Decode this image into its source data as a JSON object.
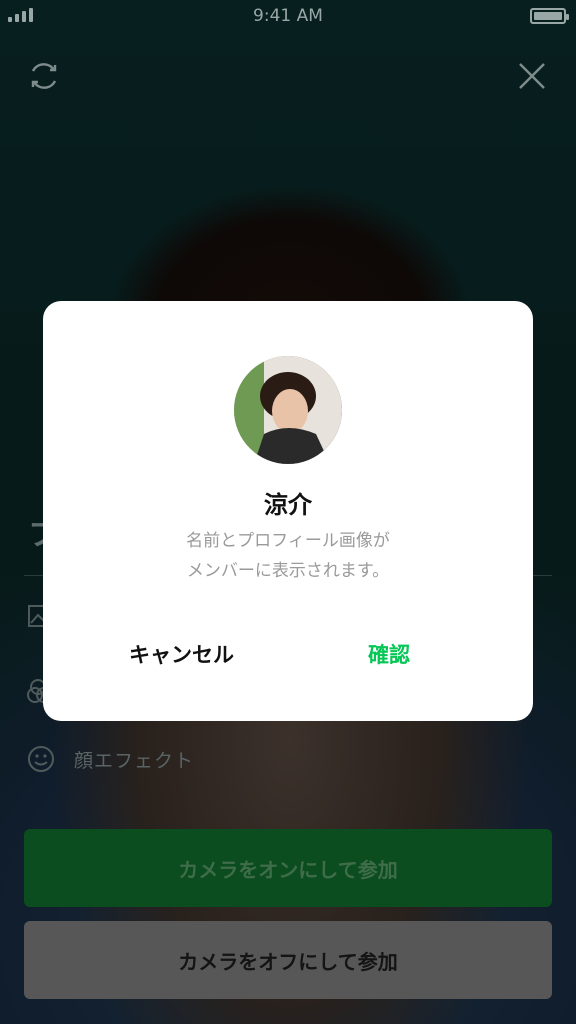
{
  "status_bar": {
    "time": "9:41 AM"
  },
  "side": {
    "face_effect_label": "顔エフェクト"
  },
  "buttons": {
    "camera_on": "カメラをオンにして参加",
    "camera_off": "カメラをオフにして参加"
  },
  "dialog": {
    "name": "涼介",
    "description_line1": "名前とプロフィール画像が",
    "description_line2": "メンバーに表示されます。",
    "cancel_label": "キャンセル",
    "confirm_label": "確認"
  },
  "colors": {
    "accent_green": "#06c755",
    "camera_on_bg": "#0b4d1e",
    "camera_off_bg": "#575757"
  },
  "icons": [
    "refresh-icon",
    "close-icon",
    "image-icon",
    "filter-icon",
    "smile-icon",
    "signal-icon",
    "battery-icon"
  ]
}
